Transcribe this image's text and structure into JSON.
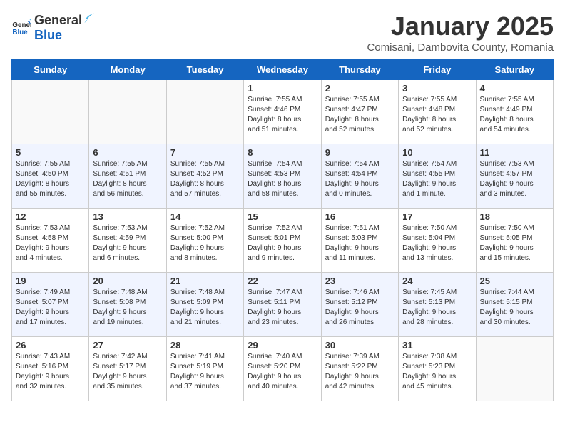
{
  "logo": {
    "general": "General",
    "blue": "Blue"
  },
  "title": "January 2025",
  "subtitle": "Comisani, Dambovita County, Romania",
  "days_of_week": [
    "Sunday",
    "Monday",
    "Tuesday",
    "Wednesday",
    "Thursday",
    "Friday",
    "Saturday"
  ],
  "weeks": [
    [
      {
        "day": "",
        "info": ""
      },
      {
        "day": "",
        "info": ""
      },
      {
        "day": "",
        "info": ""
      },
      {
        "day": "1",
        "info": "Sunrise: 7:55 AM\nSunset: 4:46 PM\nDaylight: 8 hours\nand 51 minutes."
      },
      {
        "day": "2",
        "info": "Sunrise: 7:55 AM\nSunset: 4:47 PM\nDaylight: 8 hours\nand 52 minutes."
      },
      {
        "day": "3",
        "info": "Sunrise: 7:55 AM\nSunset: 4:48 PM\nDaylight: 8 hours\nand 52 minutes."
      },
      {
        "day": "4",
        "info": "Sunrise: 7:55 AM\nSunset: 4:49 PM\nDaylight: 8 hours\nand 54 minutes."
      }
    ],
    [
      {
        "day": "5",
        "info": "Sunrise: 7:55 AM\nSunset: 4:50 PM\nDaylight: 8 hours\nand 55 minutes."
      },
      {
        "day": "6",
        "info": "Sunrise: 7:55 AM\nSunset: 4:51 PM\nDaylight: 8 hours\nand 56 minutes."
      },
      {
        "day": "7",
        "info": "Sunrise: 7:55 AM\nSunset: 4:52 PM\nDaylight: 8 hours\nand 57 minutes."
      },
      {
        "day": "8",
        "info": "Sunrise: 7:54 AM\nSunset: 4:53 PM\nDaylight: 8 hours\nand 58 minutes."
      },
      {
        "day": "9",
        "info": "Sunrise: 7:54 AM\nSunset: 4:54 PM\nDaylight: 9 hours\nand 0 minutes."
      },
      {
        "day": "10",
        "info": "Sunrise: 7:54 AM\nSunset: 4:55 PM\nDaylight: 9 hours\nand 1 minute."
      },
      {
        "day": "11",
        "info": "Sunrise: 7:53 AM\nSunset: 4:57 PM\nDaylight: 9 hours\nand 3 minutes."
      }
    ],
    [
      {
        "day": "12",
        "info": "Sunrise: 7:53 AM\nSunset: 4:58 PM\nDaylight: 9 hours\nand 4 minutes."
      },
      {
        "day": "13",
        "info": "Sunrise: 7:53 AM\nSunset: 4:59 PM\nDaylight: 9 hours\nand 6 minutes."
      },
      {
        "day": "14",
        "info": "Sunrise: 7:52 AM\nSunset: 5:00 PM\nDaylight: 9 hours\nand 8 minutes."
      },
      {
        "day": "15",
        "info": "Sunrise: 7:52 AM\nSunset: 5:01 PM\nDaylight: 9 hours\nand 9 minutes."
      },
      {
        "day": "16",
        "info": "Sunrise: 7:51 AM\nSunset: 5:03 PM\nDaylight: 9 hours\nand 11 minutes."
      },
      {
        "day": "17",
        "info": "Sunrise: 7:50 AM\nSunset: 5:04 PM\nDaylight: 9 hours\nand 13 minutes."
      },
      {
        "day": "18",
        "info": "Sunrise: 7:50 AM\nSunset: 5:05 PM\nDaylight: 9 hours\nand 15 minutes."
      }
    ],
    [
      {
        "day": "19",
        "info": "Sunrise: 7:49 AM\nSunset: 5:07 PM\nDaylight: 9 hours\nand 17 minutes."
      },
      {
        "day": "20",
        "info": "Sunrise: 7:48 AM\nSunset: 5:08 PM\nDaylight: 9 hours\nand 19 minutes."
      },
      {
        "day": "21",
        "info": "Sunrise: 7:48 AM\nSunset: 5:09 PM\nDaylight: 9 hours\nand 21 minutes."
      },
      {
        "day": "22",
        "info": "Sunrise: 7:47 AM\nSunset: 5:11 PM\nDaylight: 9 hours\nand 23 minutes."
      },
      {
        "day": "23",
        "info": "Sunrise: 7:46 AM\nSunset: 5:12 PM\nDaylight: 9 hours\nand 26 minutes."
      },
      {
        "day": "24",
        "info": "Sunrise: 7:45 AM\nSunset: 5:13 PM\nDaylight: 9 hours\nand 28 minutes."
      },
      {
        "day": "25",
        "info": "Sunrise: 7:44 AM\nSunset: 5:15 PM\nDaylight: 9 hours\nand 30 minutes."
      }
    ],
    [
      {
        "day": "26",
        "info": "Sunrise: 7:43 AM\nSunset: 5:16 PM\nDaylight: 9 hours\nand 32 minutes."
      },
      {
        "day": "27",
        "info": "Sunrise: 7:42 AM\nSunset: 5:17 PM\nDaylight: 9 hours\nand 35 minutes."
      },
      {
        "day": "28",
        "info": "Sunrise: 7:41 AM\nSunset: 5:19 PM\nDaylight: 9 hours\nand 37 minutes."
      },
      {
        "day": "29",
        "info": "Sunrise: 7:40 AM\nSunset: 5:20 PM\nDaylight: 9 hours\nand 40 minutes."
      },
      {
        "day": "30",
        "info": "Sunrise: 7:39 AM\nSunset: 5:22 PM\nDaylight: 9 hours\nand 42 minutes."
      },
      {
        "day": "31",
        "info": "Sunrise: 7:38 AM\nSunset: 5:23 PM\nDaylight: 9 hours\nand 45 minutes."
      },
      {
        "day": "",
        "info": ""
      }
    ]
  ]
}
